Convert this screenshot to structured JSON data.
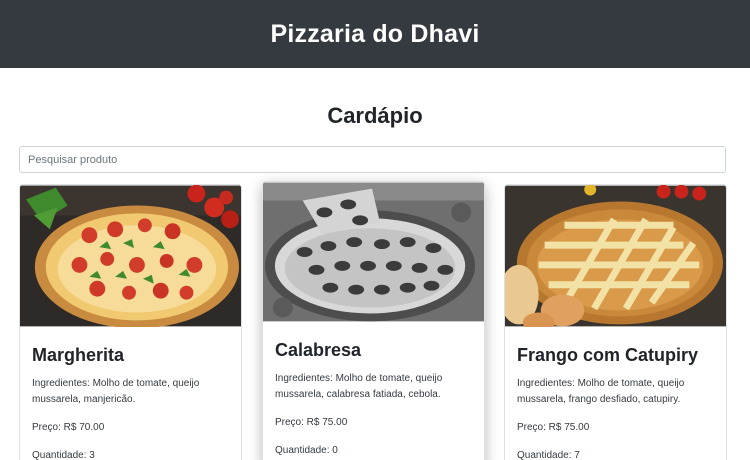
{
  "header": {
    "title": "Pizzaria do Dhavi"
  },
  "main": {
    "title": "Cardápio",
    "search": {
      "placeholder": "Pesquisar produto",
      "value": ""
    }
  },
  "products": [
    {
      "name": "Margherita",
      "ingredients": "Ingredientes: Molho de tomate, queijo mussarela, manjericão.",
      "price": "Preço: R$ 70.00",
      "quantity": "Quantidade: 3",
      "image_icon": "pizza-margherita-photo"
    },
    {
      "name": "Calabresa",
      "ingredients": "Ingredientes: Molho de tomate, queijo mussarela, calabresa fatiada, cebola.",
      "price": "Preço: R$ 75.00",
      "quantity": "Quantidade: 0",
      "image_icon": "pizza-calabresa-photo-grayscale"
    },
    {
      "name": "Frango com Catupiry",
      "ingredients": "Ingredientes: Molho de tomate, queijo mussarela, frango desfiado, catupiry.",
      "price": "Preço: R$ 75.00",
      "quantity": "Quantidade: 7",
      "image_icon": "pizza-frango-catupiry-photo"
    }
  ],
  "colors": {
    "navbar": "#343a40",
    "text": "#212529",
    "border": "#dfe2e5"
  }
}
